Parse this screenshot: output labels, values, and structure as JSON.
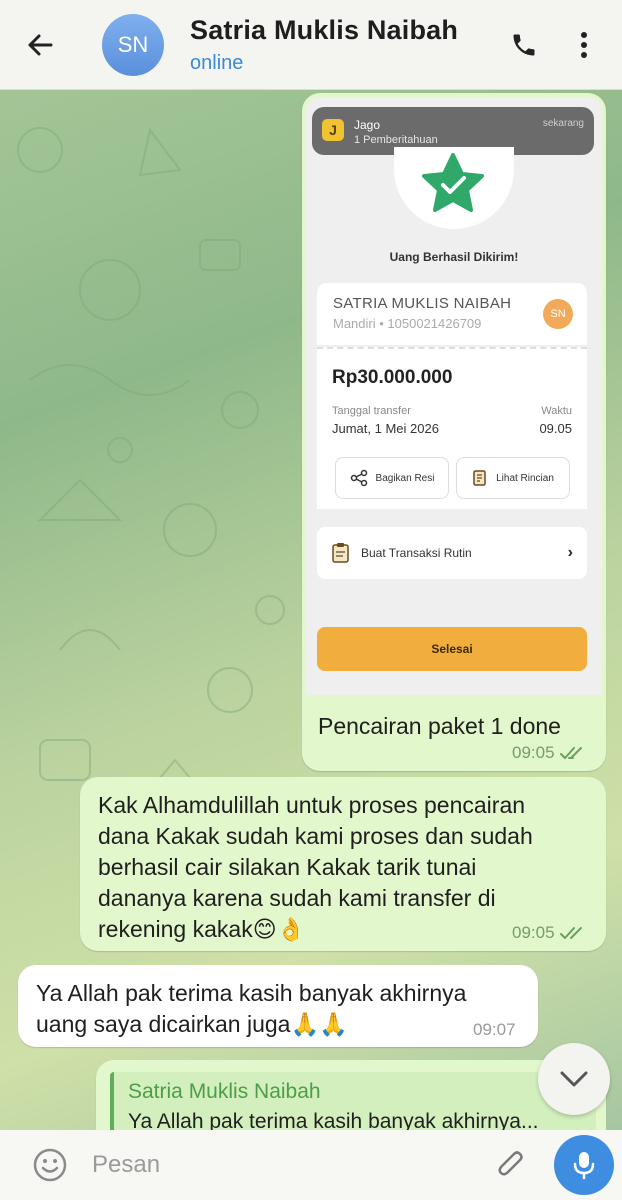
{
  "header": {
    "avatar_initials": "SN",
    "contact_name": "Satria Muklis Naibah",
    "status": "online"
  },
  "receipt": {
    "notification": {
      "app": "Jago",
      "text": "1 Pemberitahuan",
      "time": "sekarang",
      "icon_letter": "J"
    },
    "success_title": "Uang Berhasil Dikirim!",
    "recipient_name": "SATRIA MUKLIS NAIBAH",
    "recipient_account": "Mandiri • 1050021426709",
    "recipient_initials": "SN",
    "amount": "Rp30.000.000",
    "date_label": "Tanggal transfer",
    "date_value": "Jumat, 1 Mei 2026",
    "time_label": "Waktu",
    "time_value": "09.05",
    "share_button": "Bagikan Resi",
    "details_button": "Lihat Rincian",
    "routine_label": "Buat Transaksi Rutin",
    "done_button": "Selesai"
  },
  "messages": [
    {
      "direction": "out",
      "text": "Pencairan paket 1 done",
      "time": "09:05"
    },
    {
      "direction": "out",
      "lines": [
        "Kak Alhamdulillah untuk proses pencairan",
        "dana Kakak sudah kami proses dan sudah",
        "berhasil cair silakan Kakak tarik tunai",
        "dananya karena sudah kami transfer di",
        "rekening kakak😊👌"
      ],
      "time": "09:05"
    },
    {
      "direction": "in",
      "lines": [
        "Ya Allah pak terima kasih banyak akhirnya",
        "uang saya dicairkan juga🙏🙏"
      ],
      "time": "09:07"
    }
  ],
  "reply_preview": {
    "author": "Satria Muklis Naibah",
    "text": "Ya Allah pak terima kasih banyak akhirnya..."
  },
  "input": {
    "placeholder": "Pesan"
  },
  "colors": {
    "outgoing_bubble": "#e2f7cb",
    "incoming_bubble": "#ffffff",
    "accent": "#3f8de0",
    "receipt_button": "#f2ae3c",
    "star": "#2fa86a"
  }
}
